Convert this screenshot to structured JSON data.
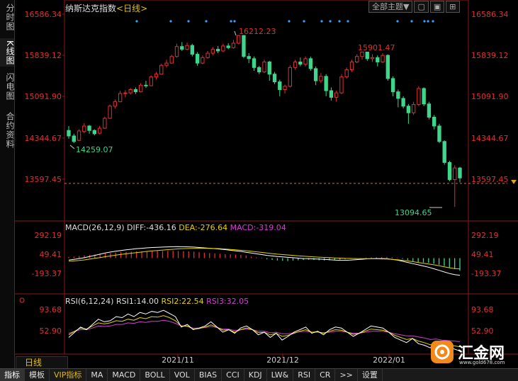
{
  "sidebar": {
    "tabs": [
      {
        "label": "分时图",
        "active": false
      },
      {
        "label": "K线图",
        "active": true
      },
      {
        "label": "闪电图",
        "active": false
      },
      {
        "label": "合约资料",
        "active": false
      }
    ]
  },
  "header": {
    "instrument": "纳斯达克指数",
    "period_tag": "<日线>",
    "theme_label": "全部主题▼"
  },
  "price_axis": {
    "left": [
      "16586.34",
      "15839.12",
      "15091.90",
      "14344.67",
      "13597.45"
    ],
    "right": [
      "16586.34",
      "15839.12",
      "15091.90",
      "14344.67",
      "13597.45"
    ],
    "current": "13597.45"
  },
  "annotations": {
    "high1": "16212.23",
    "high2": "15901.47",
    "low1": "14259.07",
    "low2": "13094.65"
  },
  "macd": {
    "title": "MACD(26,12,9)",
    "diff": "DIFF:-436.16",
    "dea": "DEA:-276.64",
    "macd": "MACD:-319.04",
    "axis": [
      "292.19",
      "49.41",
      "-193.37"
    ]
  },
  "rsi": {
    "title": "RSI(6,12,24)",
    "rsi1": "RSI1:14.00",
    "rsi2": "RSI2:22.54",
    "rsi3": "RSI3:32.05",
    "axis": [
      "93.68",
      "52.90"
    ]
  },
  "dates": [
    "2021/11",
    "2021/12",
    "2022/01"
  ],
  "period_button": "日线",
  "bottom_tabs": [
    "指标",
    "模板",
    "VIP指标",
    "MA",
    "MACD",
    "BOLL",
    "VOL",
    "BIAS",
    "CCI",
    "KDJ",
    "LW&",
    "RSI",
    "CR",
    ">>",
    "设置"
  ],
  "watermark": {
    "brand": "汇金网",
    "url": "www.gold678.com"
  },
  "colors": {
    "up": "#e03030",
    "down": "#3dd68c",
    "yellow": "#e6d200",
    "magenta": "#d040d0",
    "bg": "#000000"
  },
  "chart_data": {
    "type": "candlestick",
    "ylim": [
      13094.65,
      16586.34
    ],
    "candles": [
      [
        14480,
        14380,
        14560,
        14330
      ],
      [
        14380,
        14280,
        14420,
        14250
      ],
      [
        14300,
        14470,
        14500,
        14290
      ],
      [
        14460,
        14560,
        14610,
        14430
      ],
      [
        14560,
        14480,
        14580,
        14420
      ],
      [
        14480,
        14420,
        14500,
        14390
      ],
      [
        14430,
        14520,
        14560,
        14410
      ],
      [
        14520,
        14700,
        14730,
        14510
      ],
      [
        14700,
        14920,
        14950,
        14690
      ],
      [
        14920,
        15000,
        15040,
        14880
      ],
      [
        15000,
        15150,
        15200,
        14990
      ],
      [
        15150,
        15160,
        15210,
        15080
      ],
      [
        15160,
        15220,
        15250,
        15130
      ],
      [
        15220,
        15180,
        15260,
        15140
      ],
      [
        15180,
        15300,
        15340,
        15170
      ],
      [
        15300,
        15290,
        15380,
        15250
      ],
      [
        15290,
        15450,
        15480,
        15280
      ],
      [
        15450,
        15500,
        15540,
        15400
      ],
      [
        15500,
        15660,
        15690,
        15490
      ],
      [
        15660,
        15700,
        15760,
        15620
      ],
      [
        15700,
        15820,
        15850,
        15690
      ],
      [
        15820,
        16000,
        16050,
        15800
      ],
      [
        16000,
        15950,
        16080,
        15920
      ],
      [
        15950,
        16020,
        16070,
        15930
      ],
      [
        16020,
        15860,
        16050,
        15820
      ],
      [
        15860,
        15700,
        15900,
        15650
      ],
      [
        15700,
        15800,
        15840,
        15680
      ],
      [
        15800,
        15880,
        15920,
        15780
      ],
      [
        15880,
        15950,
        15990,
        15840
      ],
      [
        15950,
        15920,
        16010,
        15880
      ],
      [
        15920,
        16010,
        16050,
        15900
      ],
      [
        16010,
        15980,
        16060,
        15950
      ],
      [
        15980,
        16060,
        16120,
        15960
      ],
      [
        16060,
        16200,
        16212,
        16040
      ],
      [
        16200,
        15820,
        16210,
        15790
      ],
      [
        15820,
        15780,
        15880,
        15700
      ],
      [
        15780,
        15620,
        15820,
        15560
      ],
      [
        15620,
        15540,
        15650,
        15500
      ],
      [
        15540,
        15720,
        15760,
        15520
      ],
      [
        15720,
        15500,
        15740,
        15380
      ],
      [
        15500,
        15360,
        15540,
        15320
      ],
      [
        15360,
        15220,
        15400,
        15100
      ],
      [
        15220,
        15280,
        15310,
        15150
      ],
      [
        15280,
        15620,
        15660,
        15260
      ],
      [
        15620,
        15720,
        15760,
        15580
      ],
      [
        15720,
        15680,
        15800,
        15640
      ],
      [
        15680,
        15780,
        15820,
        15640
      ],
      [
        15780,
        15600,
        15820,
        15560
      ],
      [
        15600,
        15380,
        15640,
        15300
      ],
      [
        15380,
        15460,
        15520,
        15340
      ],
      [
        15460,
        15200,
        15500,
        15100
      ],
      [
        15200,
        15080,
        15260,
        15020
      ],
      [
        15080,
        15160,
        15200,
        15000
      ],
      [
        15160,
        15450,
        15500,
        15140
      ],
      [
        15450,
        15580,
        15620,
        15420
      ],
      [
        15580,
        15720,
        15760,
        15540
      ],
      [
        15720,
        15820,
        15860,
        15700
      ],
      [
        15820,
        15900,
        15901,
        15760
      ],
      [
        15900,
        15780,
        15900,
        15740
      ],
      [
        15780,
        15800,
        15860,
        15720
      ],
      [
        15800,
        15720,
        15840,
        15640
      ],
      [
        15720,
        15840,
        15880,
        15700
      ],
      [
        15840,
        15420,
        15860,
        15380
      ],
      [
        15420,
        15180,
        15460,
        15100
      ],
      [
        15180,
        15060,
        15220,
        14900
      ],
      [
        15060,
        14920,
        15100,
        14880
      ],
      [
        14920,
        14800,
        14960,
        14600
      ],
      [
        14800,
        14950,
        15000,
        14760
      ],
      [
        14950,
        15240,
        15280,
        14920
      ],
      [
        15240,
        14960,
        15260,
        14920
      ],
      [
        14960,
        14720,
        15000,
        14680
      ],
      [
        14720,
        14560,
        14760,
        14500
      ],
      [
        14560,
        14280,
        14600,
        14250
      ],
      [
        14280,
        13900,
        14300,
        13860
      ],
      [
        13900,
        13590,
        13930,
        13560
      ],
      [
        13590,
        13800,
        13850,
        13094.65
      ],
      [
        13800,
        13620,
        13820,
        13540
      ]
    ],
    "macd": {
      "hist": [
        30,
        40,
        55,
        70,
        80,
        95,
        110,
        120,
        130,
        140,
        150,
        158,
        165,
        170,
        172,
        175,
        178,
        180,
        182,
        185,
        184,
        182,
        178,
        172,
        165,
        150,
        138,
        128,
        120,
        110,
        100,
        95,
        90,
        86,
        70,
        40,
        20,
        -10,
        -30,
        -45,
        -60,
        -70,
        -75,
        -65,
        -55,
        -45,
        -40,
        -45,
        -55,
        -60,
        -55,
        -50,
        -40,
        -30,
        -20,
        -10,
        5,
        15,
        20,
        25,
        28,
        30,
        25,
        10,
        -20,
        -50,
        -80,
        -100,
        -110,
        -120,
        -140,
        -170,
        -200,
        -240,
        -280,
        -319
      ],
      "dif": [
        -50,
        -30,
        -10,
        10,
        40,
        70,
        100,
        130,
        155,
        175,
        195,
        210,
        225,
        240,
        250,
        260,
        270,
        275,
        280,
        285,
        290,
        292,
        290,
        285,
        280,
        270,
        260,
        250,
        240,
        230,
        215,
        200,
        185,
        170,
        150,
        130,
        110,
        90,
        70,
        55,
        40,
        30,
        20,
        10,
        0,
        -10,
        -15,
        -20,
        -25,
        -30,
        -40,
        -50,
        -55,
        -55,
        -50,
        -40,
        -30,
        -20,
        -15,
        -10,
        -10,
        -15,
        -30,
        -50,
        -80,
        -110,
        -140,
        -170,
        -200,
        -230,
        -270,
        -310,
        -350,
        -390,
        -420,
        -436
      ],
      "dea": [
        -80,
        -70,
        -60,
        -45,
        -25,
        -5,
        15,
        35,
        55,
        75,
        95,
        110,
        125,
        140,
        155,
        170,
        185,
        195,
        205,
        215,
        225,
        235,
        240,
        245,
        248,
        250,
        250,
        248,
        245,
        240,
        232,
        222,
        212,
        200,
        188,
        175,
        160,
        145,
        130,
        115,
        100,
        90,
        80,
        70,
        60,
        50,
        40,
        32,
        25,
        18,
        12,
        5,
        0,
        -5,
        -8,
        -10,
        -12,
        -14,
        -16,
        -18,
        -20,
        -24,
        -30,
        -40,
        -55,
        -70,
        -90,
        -110,
        -130,
        -150,
        -170,
        -195,
        -220,
        -245,
        -265,
        -276
      ]
    },
    "rsi": {
      "rsi1": [
        40,
        50,
        60,
        55,
        65,
        75,
        70,
        72,
        80,
        78,
        85,
        80,
        88,
        85,
        90,
        88,
        92,
        86,
        80,
        60,
        65,
        55,
        58,
        62,
        70,
        60,
        50,
        55,
        48,
        58,
        62,
        55,
        45,
        50,
        40,
        48,
        35,
        42,
        50,
        55,
        60,
        48,
        52,
        45,
        55,
        60,
        58,
        50,
        42,
        48,
        55,
        62,
        60,
        58,
        50,
        40,
        35,
        30,
        38,
        28,
        25,
        20,
        30,
        26,
        22,
        18,
        14
      ],
      "rsi2": [
        45,
        52,
        58,
        56,
        62,
        68,
        66,
        68,
        72,
        71,
        75,
        73,
        78,
        76,
        80,
        79,
        82,
        78,
        72,
        62,
        62,
        56,
        57,
        60,
        64,
        60,
        54,
        55,
        50,
        55,
        58,
        55,
        49,
        50,
        45,
        48,
        42,
        44,
        48,
        52,
        55,
        50,
        51,
        48,
        52,
        55,
        54,
        50,
        46,
        48,
        52,
        56,
        55,
        54,
        50,
        44,
        40,
        36,
        38,
        33,
        30,
        26,
        30,
        28,
        26,
        24,
        22
      ],
      "rsi3": [
        48,
        52,
        55,
        55,
        58,
        62,
        61,
        62,
        65,
        65,
        68,
        67,
        70,
        69,
        71,
        71,
        73,
        71,
        67,
        62,
        61,
        58,
        58,
        59,
        61,
        59,
        56,
        56,
        53,
        55,
        56,
        55,
        52,
        52,
        49,
        50,
        47,
        47,
        49,
        51,
        52,
        50,
        50,
        49,
        50,
        52,
        52,
        50,
        48,
        48,
        50,
        52,
        52,
        52,
        50,
        47,
        45,
        43,
        43,
        41,
        39,
        36,
        37,
        35,
        34,
        33,
        32
      ]
    },
    "rsi_ylim": [
      0,
      100
    ]
  }
}
